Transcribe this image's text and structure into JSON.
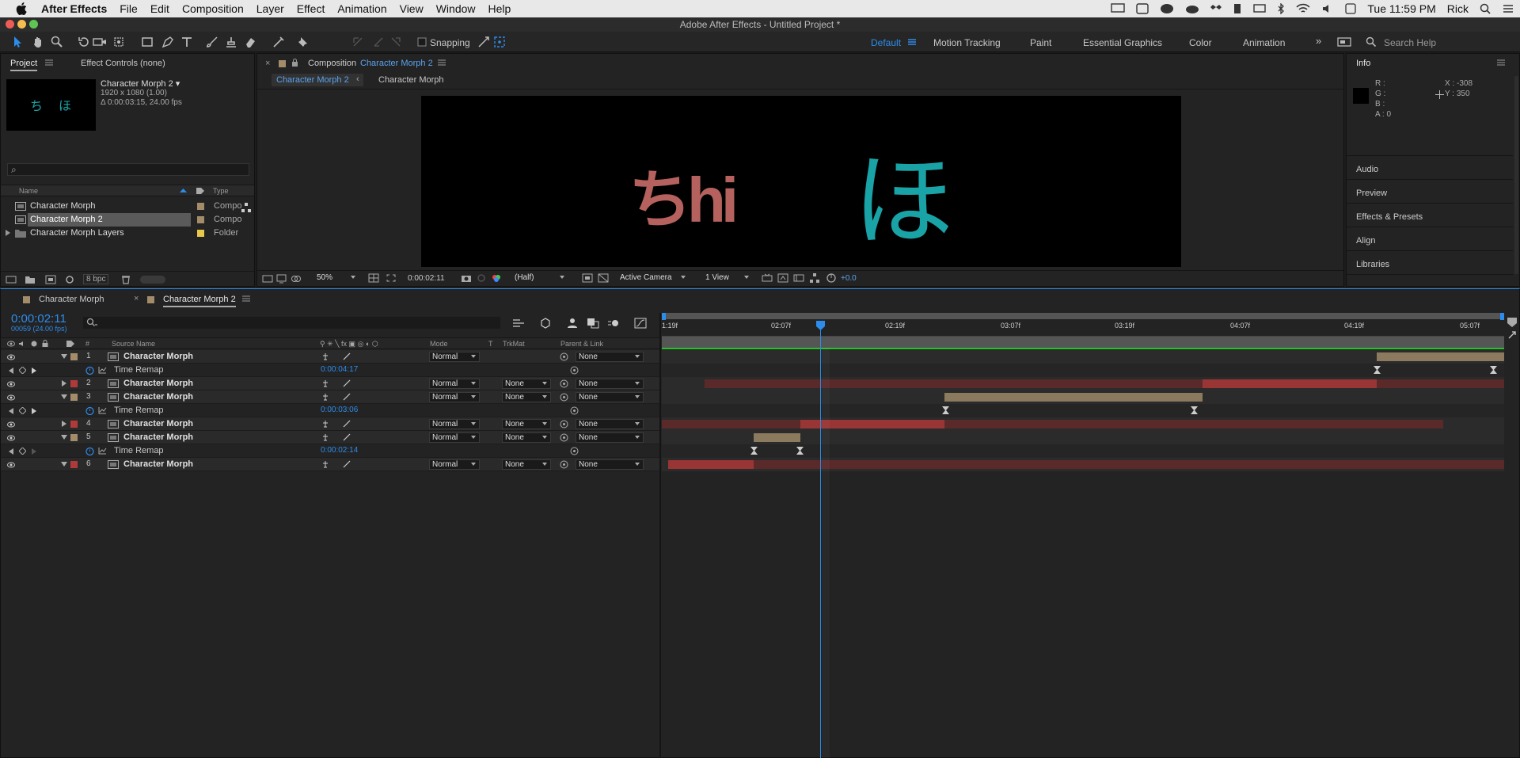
{
  "menubar": {
    "apple": "",
    "app": "After Effects",
    "items": [
      "File",
      "Edit",
      "Composition",
      "Layer",
      "Effect",
      "Animation",
      "View",
      "Window",
      "Help"
    ],
    "clock": "Tue 11:59 PM",
    "user": "Rick"
  },
  "window_title": "Adobe After Effects - Untitled Project *",
  "toolbar": {
    "snapping": "Snapping",
    "workspaces": [
      "Default",
      "Motion Tracking",
      "Paint",
      "Essential Graphics",
      "Color",
      "Animation"
    ],
    "search_placeholder": "Search Help"
  },
  "project": {
    "tab_project": "Project",
    "tab_effect_controls": "Effect Controls (none)",
    "selected_name": "Character Morph 2 ▾",
    "selected_info1": "1920 x 1080 (1.00)",
    "selected_info2": "Δ 0:00:03:15, 24.00 fps",
    "thumb_chars": [
      "ち",
      "ほ"
    ],
    "search_glyph": "⌕",
    "col_name": "Name",
    "col_type": "Type",
    "items": [
      {
        "name": "Character Morph",
        "type": "Compo",
        "color": "#a48c6a"
      },
      {
        "name": "Character Morph 2",
        "type": "Compo",
        "color": "#a48c6a"
      },
      {
        "name": "Character Morph Layers",
        "type": "Folder",
        "color": "#e8c84a"
      }
    ],
    "bpc": "8 bpc"
  },
  "composition": {
    "tab_prefix": "Composition",
    "tab_name": "Character Morph 2",
    "sub_tabs": [
      "Character Morph 2",
      "Character Morph"
    ],
    "zoom": "50%",
    "timecode": "0:00:02:11",
    "resolution": "(Half)",
    "camera": "Active Camera",
    "views": "1 View",
    "exposure": "+0.0",
    "morph_text": "ちhi",
    "ho_text": "ほ"
  },
  "info": {
    "title": "Info",
    "r": "R :",
    "g": "G :",
    "b": "B :",
    "a": "A : 0",
    "x": "X : -308",
    "y": "Y : 350",
    "sections": [
      "Audio",
      "Preview",
      "Effects & Presets",
      "Align",
      "Libraries"
    ]
  },
  "timeline": {
    "tabs": [
      "Character Morph",
      "Character Morph 2"
    ],
    "timecode": "0:00:02:11",
    "frames": "00059 (24.00 fps)",
    "col_num": "#",
    "col_source": "Source Name",
    "col_mode": "Mode",
    "col_t": "T",
    "col_trkmat": "TrkMat",
    "col_parent": "Parent & Link",
    "ruler": [
      "1:19f",
      "02:07f",
      "02:19f",
      "03:07f",
      "03:19f",
      "04:07f",
      "04:19f",
      "05:07f"
    ],
    "layers": [
      {
        "num": "1",
        "name": "Character Morph",
        "mode": "Normal",
        "trkmat": "",
        "parent": "None",
        "color": "#a48c6a",
        "expanded": true
      },
      {
        "remap": true,
        "label": "Time Remap",
        "value": "0:00:04:17"
      },
      {
        "num": "2",
        "name": "Character Morph",
        "mode": "Normal",
        "trkmat": "None",
        "parent": "None",
        "color": "#b03a3a",
        "expanded": false
      },
      {
        "num": "3",
        "name": "Character Morph",
        "mode": "Normal",
        "trkmat": "None",
        "parent": "None",
        "color": "#a48c6a",
        "expanded": true
      },
      {
        "remap": true,
        "label": "Time Remap",
        "value": "0:00:03:06"
      },
      {
        "num": "4",
        "name": "Character Morph",
        "mode": "Normal",
        "trkmat": "None",
        "parent": "None",
        "color": "#b03a3a",
        "expanded": false
      },
      {
        "num": "5",
        "name": "Character Morph",
        "mode": "Normal",
        "trkmat": "None",
        "parent": "None",
        "color": "#a48c6a",
        "expanded": true
      },
      {
        "remap": true,
        "label": "Time Remap",
        "value": "0:00:02:14"
      },
      {
        "num": "6",
        "name": "Character Morph",
        "mode": "Normal",
        "trkmat": "None",
        "parent": "None",
        "color": "#b03a3a",
        "expanded": true
      }
    ]
  },
  "colors": {
    "accent": "#2d8ceb",
    "layer_red": "#b03a3a",
    "layer_tan": "#a48c6a",
    "teal": "#1aa3a6",
    "morph": "#b5625e"
  }
}
